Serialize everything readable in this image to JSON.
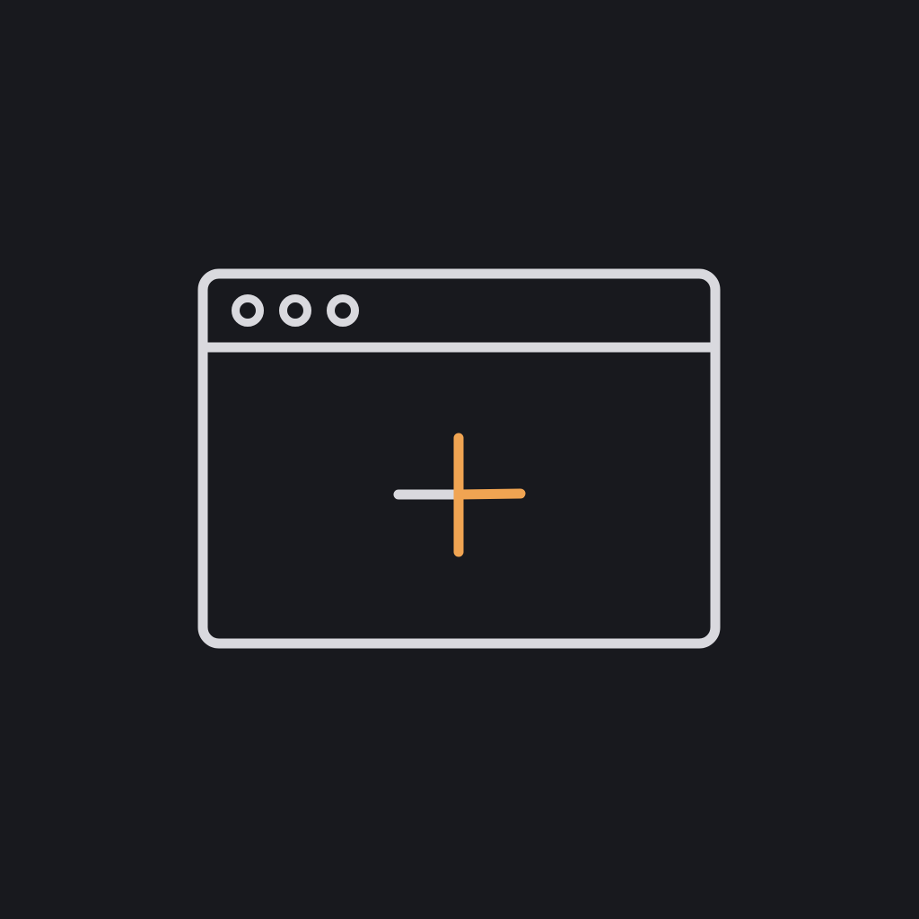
{
  "icon": {
    "name": "new-window-icon",
    "colors": {
      "background": "#18191e",
      "stroke": "#d9d9de",
      "accent": "#f0a452"
    },
    "window_control_dots": [
      "dot-1",
      "dot-2",
      "dot-3"
    ],
    "plus_symbol": "plus-icon"
  }
}
